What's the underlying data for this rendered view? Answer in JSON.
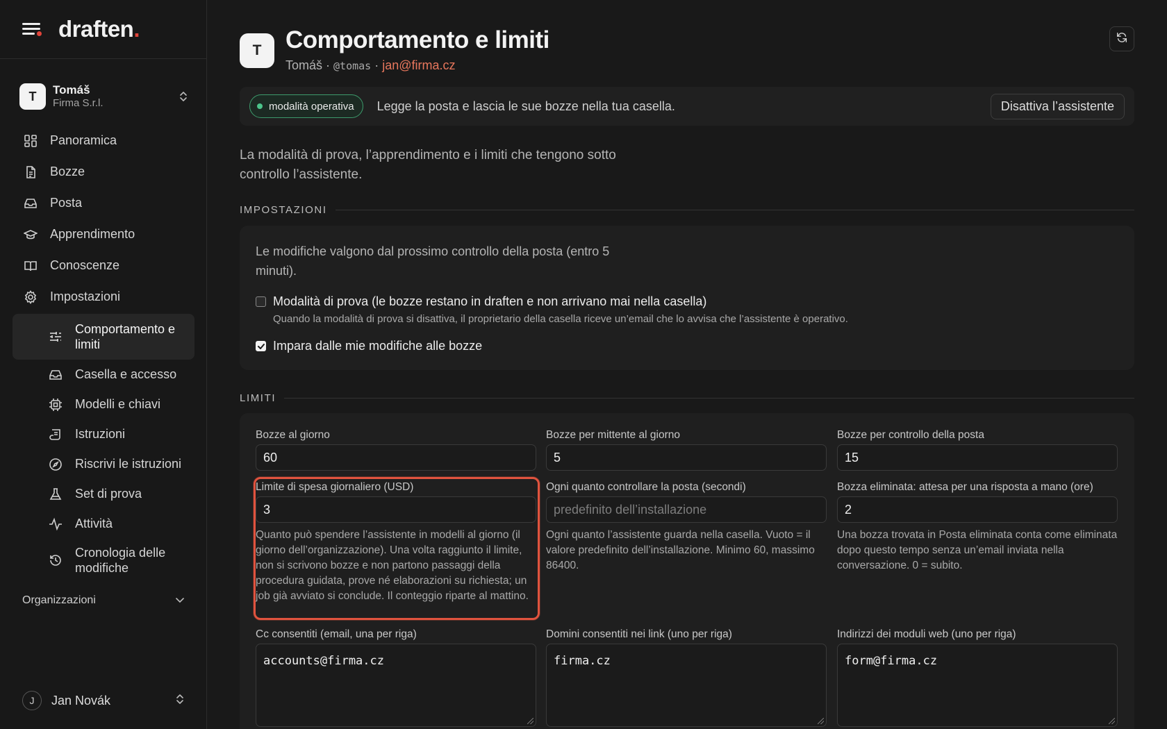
{
  "brand": {
    "name": "draften",
    "dot": "."
  },
  "account": {
    "avatar": "T",
    "name": "Tomáš",
    "org": "Firma S.r.l."
  },
  "nav": {
    "items": [
      {
        "label": "Panoramica",
        "icon": "dashboard-icon"
      },
      {
        "label": "Bozze",
        "icon": "document-icon"
      },
      {
        "label": "Posta",
        "icon": "inbox-icon"
      },
      {
        "label": "Apprendimento",
        "icon": "graduation-cap-icon"
      },
      {
        "label": "Conoscenze",
        "icon": "book-icon"
      },
      {
        "label": "Impostazioni",
        "icon": "gear-icon"
      }
    ],
    "sub": [
      {
        "label": "Comportamento e limiti",
        "icon": "sliders-icon",
        "active": true
      },
      {
        "label": "Casella e accesso",
        "icon": "inbox-icon"
      },
      {
        "label": "Modelli e chiavi",
        "icon": "chip-icon"
      },
      {
        "label": "Istruzioni",
        "icon": "scroll-icon"
      },
      {
        "label": "Riscrivi le istruzioni",
        "icon": "compass-icon"
      },
      {
        "label": "Set di prova",
        "icon": "flask-icon"
      },
      {
        "label": "Attività",
        "icon": "activity-icon"
      },
      {
        "label": "Cronologia delle modifiche",
        "icon": "history-icon"
      }
    ],
    "organizations": "Organizzazioni"
  },
  "user": {
    "initial": "J",
    "name": "Jan Novák"
  },
  "header": {
    "avatar": "T",
    "title": "Comportamento e limiti",
    "owner": "Tomáš",
    "sep1": " · ",
    "handle": "@tomas",
    "sep2": " · ",
    "email": "jan@firma.cz"
  },
  "status": {
    "badge": "modalità operativa",
    "text": "Legge la posta e lascia le sue bozze nella tua casella.",
    "button": "Disattiva l’assistente",
    "badge_color": "#4cc38a"
  },
  "intro": "La modalità di prova, l’apprendimento e i limiti che tengono sotto controllo l’assistente.",
  "settings": {
    "heading": "IMPOSTAZIONI",
    "note": "Le modifiche valgono dal prossimo controllo della posta (entro 5 minuti).",
    "trial": {
      "label": "Modalità di prova (le bozze restano in draften e non arrivano mai nella casella)",
      "help": "Quando la modalità di prova si disattiva, il proprietario della casella riceve un’email che lo avvisa che l’assistente è operativo.",
      "checked": false
    },
    "learn": {
      "label": "Impara dalle mie modifiche alle bozze",
      "checked": true
    }
  },
  "limits": {
    "heading": "LIMITI",
    "drafts_per_day": {
      "label": "Bozze al giorno",
      "value": "60"
    },
    "drafts_per_sender": {
      "label": "Bozze per mittente al giorno",
      "value": "5"
    },
    "drafts_per_check": {
      "label": "Bozze per controllo della posta",
      "value": "15"
    },
    "spend_limit": {
      "label": "Limite di spesa giornaliero (USD)",
      "value": "3",
      "help": "Quanto può spendere l’assistente in modelli al giorno (il giorno dell’organizzazione). Una volta raggiunto il limite, non si scrivono bozze e non partono passaggi della procedura guidata, prove né elaborazioni su richiesta; un job già avviato si conclude. Il conteggio riparte al mattino."
    },
    "poll_interval": {
      "label": "Ogni quanto controllare la posta (secondi)",
      "placeholder": "predefinito dell’installazione",
      "help": "Ogni quanto l’assistente guarda nella casella. Vuoto = il valore predefinito dell’installazione. Minimo 60, massimo 86400."
    },
    "deleted_wait": {
      "label": "Bozza eliminata: attesa per una risposta a mano (ore)",
      "value": "2",
      "help": "Una bozza trovata in Posta eliminata conta come eliminata dopo questo tempo senza un’email inviata nella conversazione. 0 = subito."
    },
    "cc_allowed": {
      "label": "Cc consentiti (email, una per riga)",
      "value": "accounts@firma.cz"
    },
    "link_domains": {
      "label": "Domini consentiti nei link (uno per riga)",
      "value": "firma.cz"
    },
    "form_addresses": {
      "label": "Indirizzi dei moduli web (uno per riga)",
      "value": "form@firma.cz"
    }
  }
}
